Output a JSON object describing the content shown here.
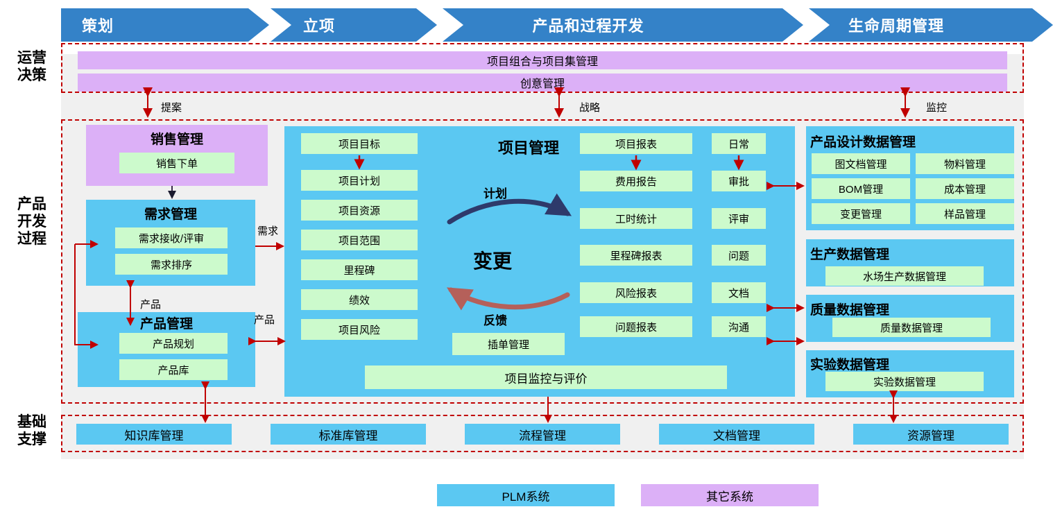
{
  "phases": [
    {
      "label": "策划"
    },
    {
      "label": "立项"
    },
    {
      "label": "产品和过程开发"
    },
    {
      "label": "生命周期管理"
    }
  ],
  "row_labels": [
    {
      "line1": "运营",
      "line2": "决策"
    },
    {
      "line1": "产品",
      "line2": "开发",
      "line3": "过程"
    },
    {
      "line1": "基础",
      "line2": "支撑"
    }
  ],
  "operations_decision": {
    "bars": [
      {
        "label": "项目组合与项目集管理"
      },
      {
        "label": "创意管理"
      }
    ]
  },
  "connectors": [
    {
      "label": "提案"
    },
    {
      "label": "战略"
    },
    {
      "label": "监控"
    }
  ],
  "sales_management": {
    "title": "销售管理",
    "items": [
      {
        "label": "销售下单"
      }
    ]
  },
  "requirement_management": {
    "title": "需求管理",
    "items": [
      {
        "label": "需求接收/评审"
      },
      {
        "label": "需求排序"
      }
    ]
  },
  "product_management": {
    "title": "产品管理",
    "items": [
      {
        "label": "产品规划"
      },
      {
        "label": "产品库"
      }
    ]
  },
  "side_flow_labels": [
    {
      "label": "需求"
    },
    {
      "label": "产品"
    },
    {
      "label": "产品"
    }
  ],
  "project_management": {
    "title": "项目管理",
    "col1": [
      {
        "label": "项目目标"
      },
      {
        "label": "项目计划"
      },
      {
        "label": "项目资源"
      },
      {
        "label": "项目范围"
      },
      {
        "label": "里程碑"
      },
      {
        "label": "绩效"
      },
      {
        "label": "项目风险"
      }
    ],
    "col2": [
      {
        "label": "项目报表"
      },
      {
        "label": "费用报告"
      },
      {
        "label": "工时统计"
      },
      {
        "label": "里程碑报表"
      },
      {
        "label": "风险报表"
      },
      {
        "label": "问题报表"
      }
    ],
    "col3": [
      {
        "label": "日常"
      },
      {
        "label": "审批"
      },
      {
        "label": "评审"
      },
      {
        "label": "问题"
      },
      {
        "label": "文档"
      },
      {
        "label": "沟通"
      }
    ],
    "cycle_top": "计划",
    "cycle_center": "变更",
    "cycle_bottom": "反馈",
    "insert_order": "插单管理",
    "monitoring": "项目监控与评价"
  },
  "data_groups": [
    {
      "title": "产品设计数据管理",
      "items": [
        {
          "label": "图文档管理"
        },
        {
          "label": "物料管理"
        },
        {
          "label": "BOM管理"
        },
        {
          "label": "成本管理"
        },
        {
          "label": "变更管理"
        },
        {
          "label": "样品管理"
        }
      ]
    },
    {
      "title": "生产数据管理",
      "items": [
        {
          "label": "水场生产数据管理"
        }
      ]
    },
    {
      "title": "质量数据管理",
      "items": [
        {
          "label": "质量数据管理"
        }
      ]
    },
    {
      "title": "实验数据管理",
      "items": [
        {
          "label": "实验数据管理"
        }
      ]
    }
  ],
  "foundation": {
    "items": [
      {
        "label": "知识库管理"
      },
      {
        "label": "标准库管理"
      },
      {
        "label": "流程管理"
      },
      {
        "label": "文档管理"
      },
      {
        "label": "资源管理"
      }
    ]
  },
  "legend": [
    {
      "label": "PLM系统",
      "color": "#5bc8f2"
    },
    {
      "label": "其它系统",
      "color": "#dcb0f7"
    }
  ],
  "colors": {
    "phase_blue": "#3482c8",
    "plm_blue": "#5bc8f2",
    "other_purple": "#dcb0f7",
    "item_green": "#ccfacc",
    "dashed_red": "#c00000",
    "arrow_red": "#c00000",
    "plan_arrow": "#2e3a6b",
    "feedback_arrow": "#b5605a",
    "panel_grey": "#f0f0f0"
  }
}
